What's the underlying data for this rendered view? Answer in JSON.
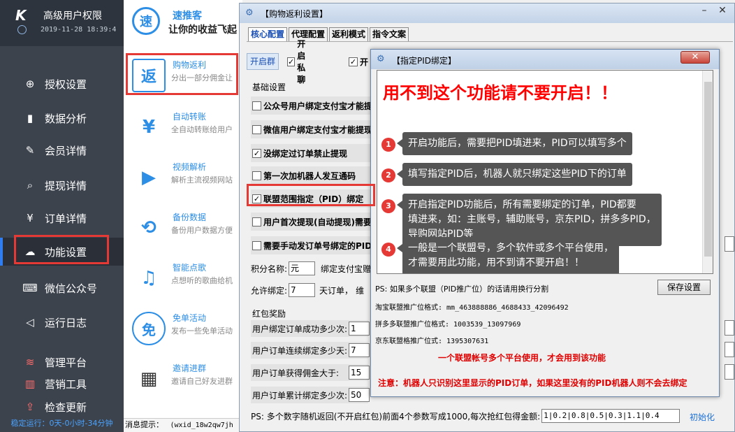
{
  "sidebar": {
    "brand_logo": "K",
    "brand_title": "高级用户权限",
    "brand_time": "2019-11-28 18:39:4",
    "items": [
      {
        "label": "授权设置",
        "icon": "globe-icon",
        "glyph": "⊕"
      },
      {
        "label": "数据分析",
        "icon": "chart-icon",
        "glyph": "▮"
      },
      {
        "label": "会员详情",
        "icon": "edit-icon",
        "glyph": "✎"
      },
      {
        "label": "提现详情",
        "icon": "search-doc-icon",
        "glyph": "⌕"
      },
      {
        "label": "订单详情",
        "icon": "yen-doc-icon",
        "glyph": "¥"
      },
      {
        "label": "功能设置",
        "icon": "wechat-icon",
        "glyph": "☁"
      },
      {
        "label": "微信公众号",
        "icon": "keyboard-icon",
        "glyph": "⌨"
      },
      {
        "label": "运行日志",
        "icon": "speaker-icon",
        "glyph": "◁"
      },
      {
        "label": "管理平台",
        "icon": "stack-icon",
        "glyph": "≋"
      },
      {
        "label": "营销工具",
        "icon": "bar-chart-icon",
        "glyph": "▥"
      },
      {
        "label": "检查更新",
        "icon": "upload-icon",
        "glyph": "⇪"
      }
    ],
    "active_index": 5,
    "status_line": "稳定运行：0天-0小时-34分钟"
  },
  "middle": {
    "logo_char": "速",
    "app_name": "速推客",
    "slogan": "让你的收益飞起",
    "features": [
      {
        "title": "购物返利",
        "desc": "分出一部分佣金让",
        "glyph": "返"
      },
      {
        "title": "自动转账",
        "desc": "全自动转账给用户",
        "glyph": "¥"
      },
      {
        "title": "视频解析",
        "desc": "解析主流视频网站",
        "glyph": "▶"
      },
      {
        "title": "备份数据",
        "desc": "备份用户数据方便",
        "glyph": "⟲"
      },
      {
        "title": "智能点歌",
        "desc": "点想听的歌曲给机",
        "glyph": "♫"
      },
      {
        "title": "免单活动",
        "desc": "发布一些免单活动",
        "glyph": "免"
      },
      {
        "title": "邀请进群",
        "desc": "邀请自己好友进群",
        "glyph": "▦"
      }
    ],
    "message_label": "消息提示：",
    "message_value": "(wxid_18w2qw7jh"
  },
  "window": {
    "title": "【购物返利设置】",
    "tabs": [
      "核心配置",
      "代理配置",
      "返利模式",
      "指令文案"
    ],
    "active_tab": 0,
    "toggle_label": "开启群",
    "chk_private": "开启私聊",
    "chk_cut": "开",
    "group_basic": "基础设置",
    "options": [
      {
        "label": "公众号用户绑定支付宝才能提",
        "checked": false
      },
      {
        "label": "微信用户绑定支付宝才能提现",
        "checked": false
      },
      {
        "label": "没绑定过订单禁止提现",
        "checked": true
      },
      {
        "label": "第一次加机器人发互通码",
        "checked": false
      },
      {
        "label": "联盟范围指定（PID）绑定",
        "checked": true
      },
      {
        "label": "用户首次提现(自动提现)需要",
        "checked": false
      },
      {
        "label": "需要手动发订单号绑定的PID",
        "checked": false
      }
    ],
    "points_label": "积分名称:",
    "points_value": "元",
    "bind_alipay_label": "绑定支付宝赠",
    "allow_bind_label": "允许绑定:",
    "allow_bind_value": "7",
    "allow_bind_suffix": "天订单，",
    "allow_bind_more": "维",
    "group_reward": "红包奖励",
    "rewards": [
      {
        "label": "用户绑定订单成功多少次:",
        "value": "1"
      },
      {
        "label": "用户订单连续绑定多少天:",
        "value": "7"
      },
      {
        "label": "用户订单获得佣金大于:",
        "value": "15"
      },
      {
        "label": "用户订单累计绑定多少次:",
        "value": "50"
      }
    ],
    "bottom_label": "PS: 多个数字随机返回(不开启红包)前面4个参数写成1000,每次抢红包得金额:",
    "bottom_value": "1|0.2|0.8|0.5|0.3|1.1|0.4",
    "init_link": "初始化"
  },
  "dialog": {
    "title": "【指定PID绑定】",
    "close_glyph": "✕",
    "headline": "用不到这个功能请不要开启！！",
    "notes": [
      {
        "num": "1",
        "lines": [
          "开启功能后，需要把PID填进来，PID可以填写多个"
        ]
      },
      {
        "num": "2",
        "lines": [
          "填写指定PID后，机器人就只绑定这些PID下的订单"
        ]
      },
      {
        "num": "3",
        "lines": [
          "开启指定PID功能后，所有需要绑定的订单，PID都要",
          "填进来，如：主账号，辅助账号，京东PID，拼多多PID，",
          "导购网站PID等"
        ]
      },
      {
        "num": "4",
        "lines": [
          "一般是一个联盟号，多个软件或多个平台使用，",
          "才需要用此功能，用不到请不要开启！！"
        ]
      }
    ],
    "ps_line": "PS: 如果多个联盟（PID推广位）的话请用换行分割",
    "save_button": "保存设置",
    "taobao_line": "淘宝联盟推广位格式: mm_463888886_4688433_42096492",
    "pdd_line": "拼多多联盟推广位格式: 1003539_13097969",
    "jd_line": "京东联盟格推广位式: 1395307631",
    "red_note_1": "一个联盟帐号多个平台使用，才会用到该功能",
    "red_note_2": "注意：机器人只识别这里显示的PID订单，如果这里没有的PID机器人则不会去绑定"
  }
}
